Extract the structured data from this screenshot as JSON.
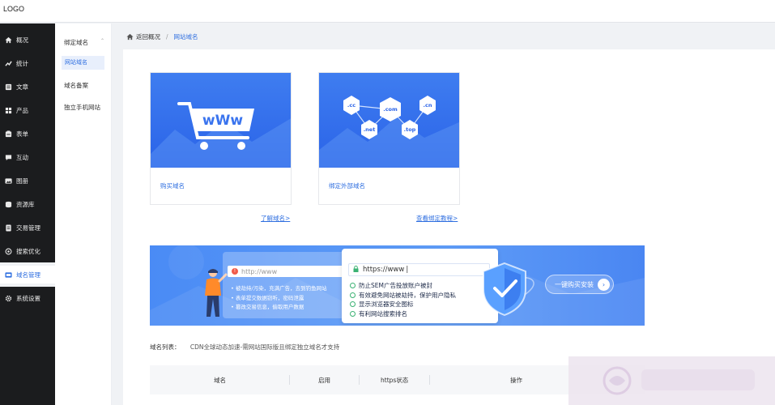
{
  "header": {
    "logo": "LOGO"
  },
  "sidebar": {
    "items": [
      {
        "label": "概况",
        "icon": "home-icon"
      },
      {
        "label": "统计",
        "icon": "stats-icon"
      },
      {
        "label": "文章",
        "icon": "article-icon"
      },
      {
        "label": "产品",
        "icon": "product-icon"
      },
      {
        "label": "表单",
        "icon": "form-icon"
      },
      {
        "label": "互动",
        "icon": "chat-icon"
      },
      {
        "label": "图册",
        "icon": "gallery-icon"
      },
      {
        "label": "资源库",
        "icon": "resource-icon"
      },
      {
        "label": "交易管理",
        "icon": "trade-icon"
      },
      {
        "label": "搜索优化",
        "icon": "seo-icon"
      },
      {
        "label": "域名管理",
        "icon": "domain-icon",
        "active": true
      },
      {
        "label": "系统设置",
        "icon": "settings-icon"
      }
    ]
  },
  "subnav": {
    "group": "绑定域名",
    "active": "网站域名",
    "items": [
      "域名备案",
      "独立手机网站"
    ]
  },
  "breadcrumb": {
    "back": "返回概况",
    "separator": "/",
    "current": "网站域名"
  },
  "cards": [
    {
      "label": "购买域名",
      "link": "了解域名>"
    },
    {
      "label": "绑定外部域名",
      "link": "查看绑定教程>",
      "tags": [
        ".cc",
        ".com",
        ".cn",
        ".net",
        ".top"
      ]
    }
  ],
  "promo": {
    "http_url": "http://www",
    "https_url": "https://www",
    "bullets": [
      "被劫持/污染，充满广告，去到钓鱼网站",
      "表单提交数据窃听，密码泄露",
      "篡改交易信息，偷取用户数据"
    ],
    "features": [
      "防止SEM广告投放账户被封",
      "有效避免网站被劫持，保护用户隐私",
      "显示浏览器安全图标",
      "有利网站搜索排名"
    ],
    "cta": "一键购买安装"
  },
  "domain_list": {
    "label": "域名列表：",
    "note": "CDN全球动态加速-需网站国际版且绑定独立域名才支持"
  },
  "table": {
    "columns": [
      "域名",
      "启用",
      "https状态",
      "操作"
    ]
  },
  "colors": {
    "accent": "#2f6fe0",
    "sidebar_bg": "#1b1c1e",
    "promo_bg": "#4a8bf5"
  }
}
